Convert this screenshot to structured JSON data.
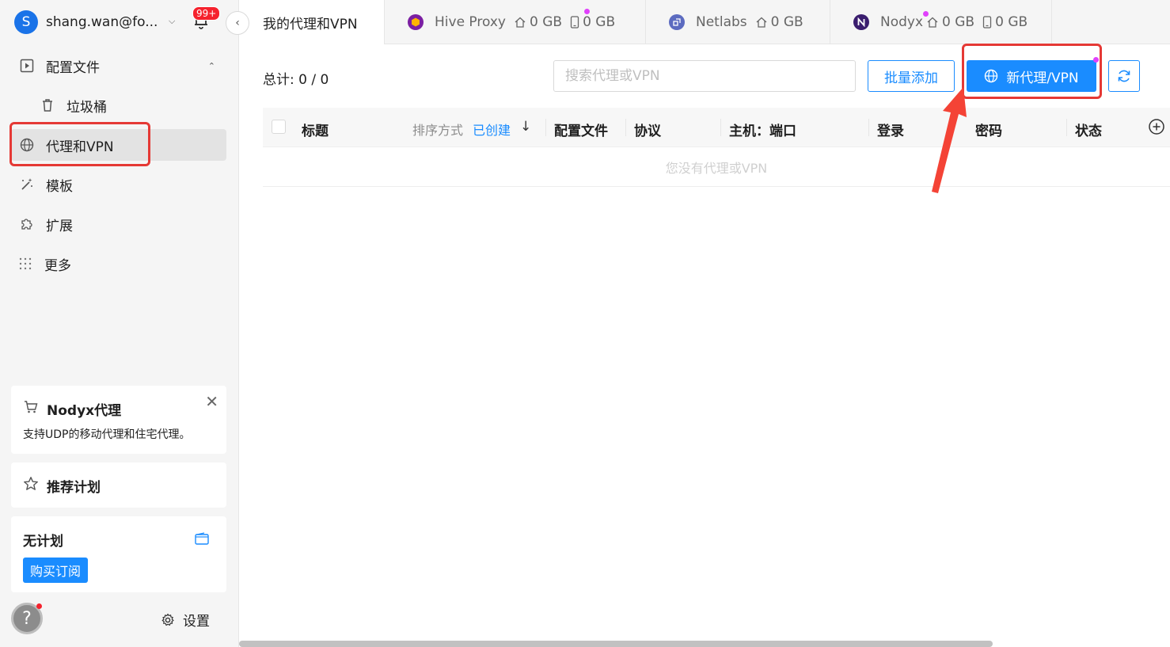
{
  "account": {
    "initial": "S",
    "name": "shang.wan@fo...",
    "notifications": "99+"
  },
  "sidebar": {
    "items": [
      {
        "label": "配置文件"
      },
      {
        "label": "垃圾桶"
      },
      {
        "label": "代理和VPN"
      },
      {
        "label": "模板"
      },
      {
        "label": "扩展"
      },
      {
        "label": "更多"
      }
    ],
    "promo": {
      "title": "Nodyx代理",
      "desc": "支持UDP的移动代理和住宅代理。"
    },
    "referral": {
      "title": "推荐计划"
    },
    "plan": {
      "title": "无计划",
      "button": "购买订阅"
    },
    "settings": "设置"
  },
  "tabs": [
    {
      "label": "我的代理和VPN"
    },
    {
      "label": "Hive Proxy",
      "home": "0 GB",
      "mobile": "0 GB",
      "color": "#ffb400"
    },
    {
      "label": "Netlabs",
      "home": "0 GB",
      "color": "#5c6bc0"
    },
    {
      "label": "Nodyx",
      "home": "0 GB",
      "mobile": "0 GB",
      "color": "#3a1d6e"
    }
  ],
  "toolbar": {
    "total_label": "总计:",
    "total_value": "0 / 0",
    "search_placeholder": "搜索代理或VPN",
    "batch_add": "批量添加",
    "new_proxy": "新代理/VPN"
  },
  "table": {
    "col_title": "标题",
    "sort_label": "排序方式",
    "sort_value": "已创建",
    "columns": [
      "配置文件",
      "协议",
      "主机：端口",
      "登录",
      "密码",
      "状态"
    ],
    "empty_text": "您没有代理或VPN"
  },
  "colors": {
    "accent": "#1a8cff",
    "highlight": "#e53935"
  }
}
